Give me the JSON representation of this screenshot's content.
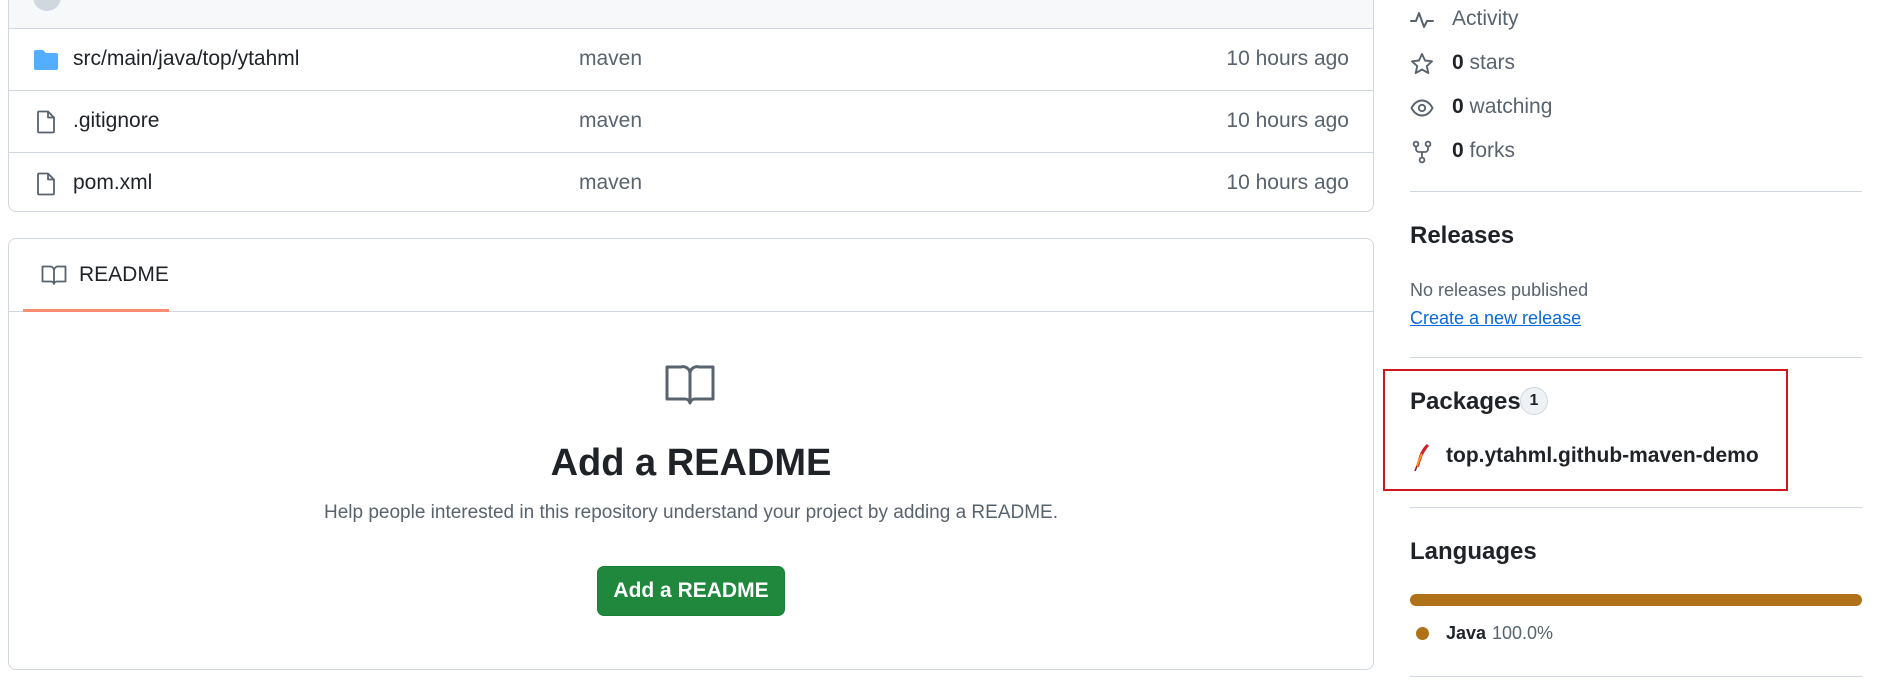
{
  "files": [
    {
      "name": "src/main/java/top/ytahml",
      "type": "folder",
      "message": "maven",
      "date": "10 hours ago"
    },
    {
      "name": ".gitignore",
      "type": "file",
      "message": "maven",
      "date": "10 hours ago"
    },
    {
      "name": "pom.xml",
      "type": "file",
      "message": "maven",
      "date": "10 hours ago"
    }
  ],
  "readme": {
    "tab_label": "README",
    "empty_title": "Add a README",
    "empty_description": "Help people interested in this repository understand your project by adding a README.",
    "add_button": "Add a README"
  },
  "sidebar": {
    "stats": {
      "activity": "Activity",
      "stars_count": "0",
      "stars_label": "stars",
      "watching_count": "0",
      "watching_label": "watching",
      "forks_count": "0",
      "forks_label": "forks"
    },
    "releases": {
      "title": "Releases",
      "none_text": "No releases published",
      "create_link": "Create a new release"
    },
    "packages": {
      "title": "Packages",
      "count": "1",
      "item": "top.ytahml.github-maven-demo"
    },
    "languages": {
      "title": "Languages",
      "items": [
        {
          "name": "Java",
          "percent": "100.0%",
          "color": "#b07219"
        }
      ]
    }
  },
  "colors": {
    "accent_green": "#1f883d",
    "link_blue": "#0969da",
    "highlight_red": "#d0191f",
    "tab_underline": "#fd8c73"
  }
}
